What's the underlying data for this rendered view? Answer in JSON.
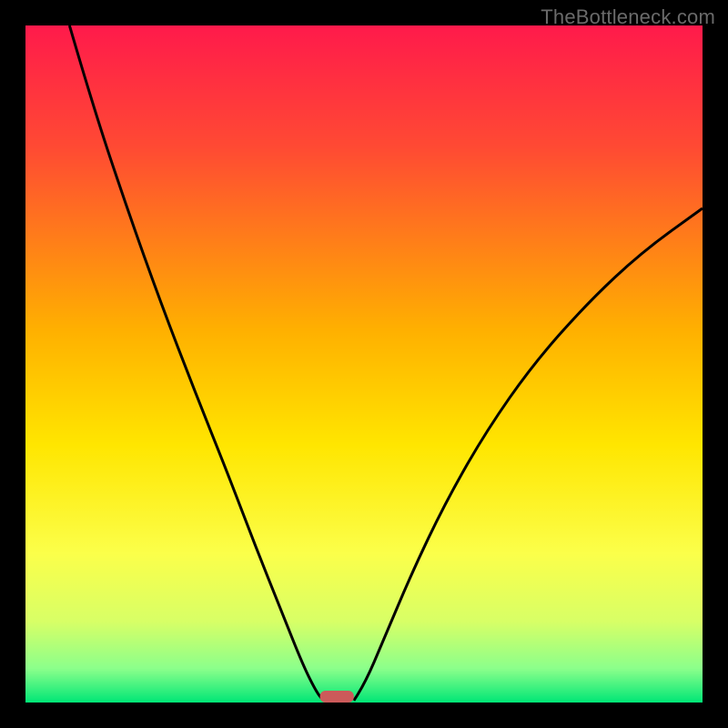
{
  "watermark": "TheBottleneck.com",
  "chart_data": {
    "type": "line",
    "title": "",
    "xlabel": "",
    "ylabel": "",
    "xlim": [
      0,
      100
    ],
    "ylim": [
      0,
      100
    ],
    "grid": false,
    "legend": false,
    "background_gradient": {
      "stops": [
        {
          "offset": 0.0,
          "color": "#ff1a4b"
        },
        {
          "offset": 0.18,
          "color": "#ff4a33"
        },
        {
          "offset": 0.45,
          "color": "#ffb000"
        },
        {
          "offset": 0.62,
          "color": "#ffe600"
        },
        {
          "offset": 0.78,
          "color": "#fbff4a"
        },
        {
          "offset": 0.88,
          "color": "#d8ff66"
        },
        {
          "offset": 0.95,
          "color": "#8bff8b"
        },
        {
          "offset": 1.0,
          "color": "#00e676"
        }
      ]
    },
    "series": [
      {
        "name": "left-curve",
        "points": [
          {
            "x": 6.5,
            "y": 100.0
          },
          {
            "x": 10.0,
            "y": 88.0
          },
          {
            "x": 15.0,
            "y": 73.0
          },
          {
            "x": 20.0,
            "y": 59.0
          },
          {
            "x": 25.0,
            "y": 46.0
          },
          {
            "x": 30.0,
            "y": 33.5
          },
          {
            "x": 34.0,
            "y": 23.0
          },
          {
            "x": 38.0,
            "y": 13.0
          },
          {
            "x": 41.0,
            "y": 5.5
          },
          {
            "x": 43.0,
            "y": 1.5
          },
          {
            "x": 44.0,
            "y": 0.3
          }
        ]
      },
      {
        "name": "right-curve",
        "points": [
          {
            "x": 48.5,
            "y": 0.3
          },
          {
            "x": 50.0,
            "y": 2.5
          },
          {
            "x": 53.0,
            "y": 9.5
          },
          {
            "x": 57.0,
            "y": 19.0
          },
          {
            "x": 62.0,
            "y": 29.5
          },
          {
            "x": 68.0,
            "y": 40.0
          },
          {
            "x": 75.0,
            "y": 50.0
          },
          {
            "x": 83.0,
            "y": 59.0
          },
          {
            "x": 91.0,
            "y": 66.5
          },
          {
            "x": 100.0,
            "y": 73.0
          }
        ]
      }
    ],
    "marker": {
      "name": "target-bar",
      "x_center": 46.0,
      "width": 5.0,
      "color": "#cc5a5a"
    }
  }
}
